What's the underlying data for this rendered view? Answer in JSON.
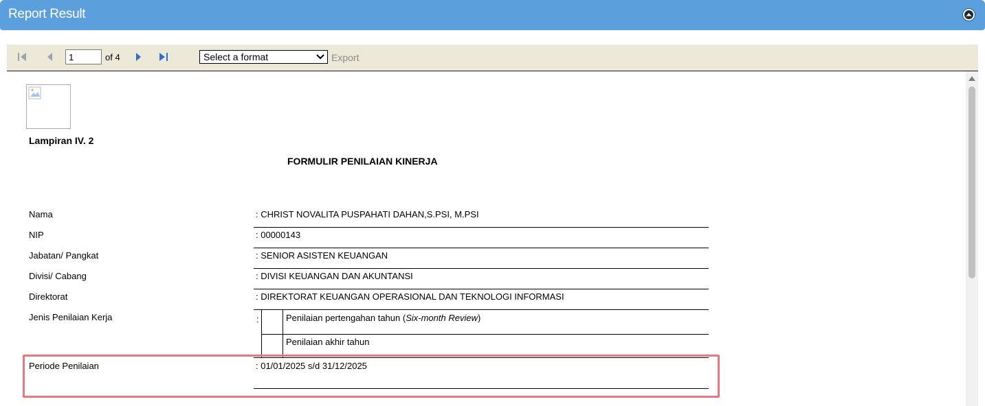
{
  "header": {
    "title": "Report Result",
    "collapse_icon": "collapse-up-icon"
  },
  "toolbar": {
    "current_page": "1",
    "of_label": "of 4",
    "format_select": {
      "selected": "Select a format"
    },
    "export_label": "Export",
    "icons": [
      "first-page-icon",
      "previous-page-icon",
      "next-page-icon",
      "last-page-icon"
    ]
  },
  "report": {
    "attachment": "Lampiran IV. 2",
    "title": "FORMULIR PENILAIAN KINERJA",
    "fields": {
      "nama": {
        "label": "Nama",
        "value": ":  CHRIST NOVALITA PUSPAHATI DAHAN,S.PSI, M.PSI"
      },
      "nip": {
        "label": "NIP",
        "value": ":  00000143"
      },
      "jabatan": {
        "label": "Jabatan/ Pangkat",
        "value": ":  SENIOR ASISTEN KEUANGAN"
      },
      "divisi": {
        "label": "Divisi/ Cabang",
        "value": ":  DIVISI KEUANGAN DAN AKUNTANSI"
      },
      "direktorat": {
        "label": "Direktorat",
        "value": ":  DIREKTORAT KEUANGAN OPERASIONAL DAN TEKNOLOGI INFORMASI"
      },
      "jenis": {
        "label": "Jenis Penilaian Kerja",
        "colon": ":",
        "option_mid_prefix": "Penilaian pertengahan tahun (",
        "option_mid_italic": "Six-month Review",
        "option_mid_suffix": ")",
        "option_end": "Penilaian akhir tahun"
      },
      "periode": {
        "label": "Periode Penilaian",
        "value": ": 01/01/2025 s/d 31/12/2025"
      }
    }
  },
  "colors": {
    "header_bg": "#5c9fdd",
    "toolbar_bg": "#ece9d8",
    "highlight_border": "#e8787c"
  }
}
